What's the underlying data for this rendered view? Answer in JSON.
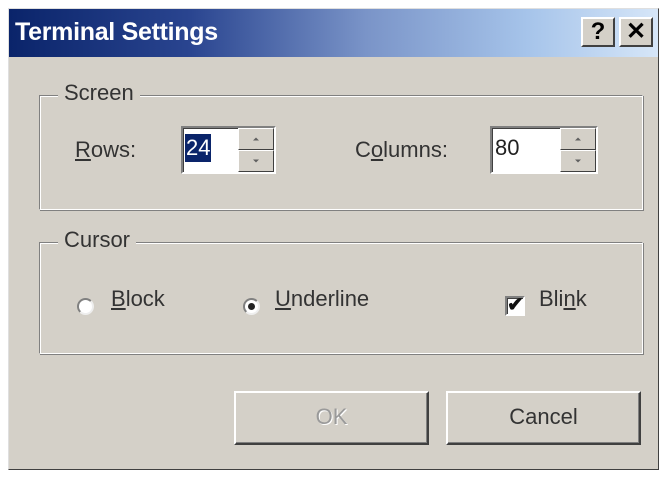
{
  "window": {
    "title": "Terminal Settings",
    "help_label": "?",
    "close_label": "✕"
  },
  "screen_group": {
    "label": "Screen",
    "rows": {
      "label_hotkey": "R",
      "label_rest": "ows:",
      "value": "24"
    },
    "columns": {
      "label_pre": "C",
      "label_hotkey": "o",
      "label_rest": "lumns:",
      "value": "80"
    }
  },
  "cursor_group": {
    "label": "Cursor",
    "block": {
      "label_hotkey": "B",
      "label_rest": "lock",
      "selected": false
    },
    "underline": {
      "label_hotkey": "U",
      "label_rest": "nderline",
      "selected": true
    },
    "blink": {
      "label_pre": "Bli",
      "label_hotkey": "n",
      "label_rest": "k",
      "checked": true,
      "check_glyph": "✔"
    }
  },
  "buttons": {
    "ok_label": "OK",
    "ok_enabled": false,
    "cancel_label": "Cancel"
  },
  "colors": {
    "dialog_face": "#d4d0c8",
    "title_gradient_start": "#0a246a",
    "title_gradient_end": "#d6e6f8",
    "selection": "#0a246a"
  }
}
